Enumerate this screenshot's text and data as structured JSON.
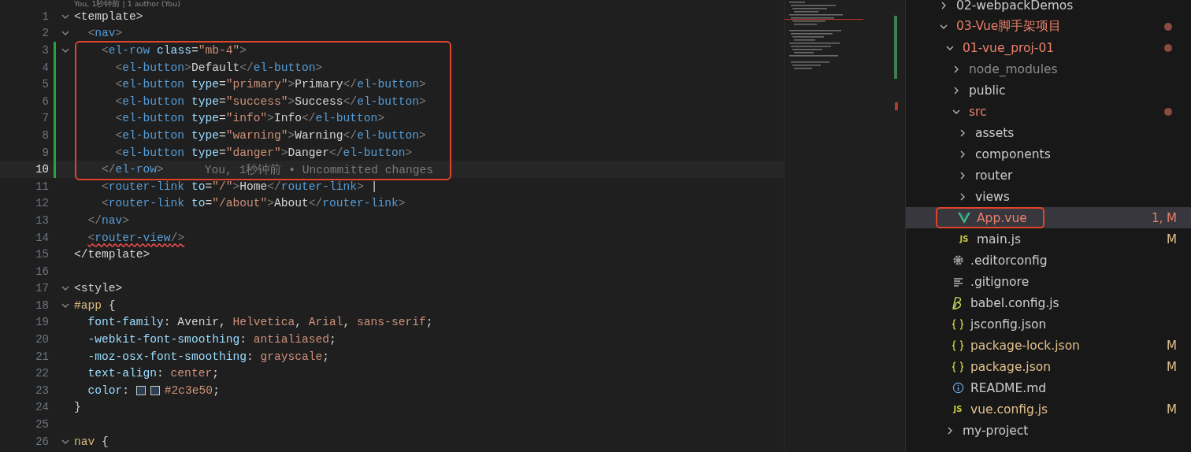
{
  "editor": {
    "codelens": "You, 1秒钟前 | 1 author (You)",
    "lines": [
      {
        "number": "1",
        "foldable": true,
        "changed": false,
        "current": false,
        "boxed": false,
        "error": false,
        "tokens": [
          {
            "kind": "text",
            "t": "<template>"
          }
        ]
      },
      {
        "number": "2",
        "foldable": true,
        "changed": false,
        "current": false,
        "boxed": false,
        "error": false,
        "tokens": [
          {
            "kind": "punct",
            "t": "  <"
          },
          {
            "kind": "tag",
            "t": "nav"
          },
          {
            "kind": "punct",
            "t": ">"
          }
        ]
      },
      {
        "number": "3",
        "foldable": true,
        "changed": true,
        "current": false,
        "boxed": true,
        "error": false,
        "tokens": [
          {
            "kind": "punct",
            "t": "    <"
          },
          {
            "kind": "tag",
            "t": "el-row"
          },
          {
            "kind": "attr",
            "t": " class"
          },
          {
            "kind": "text",
            "t": "="
          },
          {
            "kind": "str",
            "t": "\"mb-4\""
          },
          {
            "kind": "punct",
            "t": ">"
          }
        ]
      },
      {
        "number": "4",
        "foldable": false,
        "changed": true,
        "current": false,
        "boxed": true,
        "error": false,
        "tokens": [
          {
            "kind": "punct",
            "t": "      <"
          },
          {
            "kind": "tag",
            "t": "el-button"
          },
          {
            "kind": "punct",
            "t": ">"
          },
          {
            "kind": "text",
            "t": "Default"
          },
          {
            "kind": "punct",
            "t": "</"
          },
          {
            "kind": "tag",
            "t": "el-button"
          },
          {
            "kind": "punct",
            "t": ">"
          }
        ]
      },
      {
        "number": "5",
        "foldable": false,
        "changed": true,
        "current": false,
        "boxed": true,
        "error": false,
        "tokens": [
          {
            "kind": "punct",
            "t": "      <"
          },
          {
            "kind": "tag",
            "t": "el-button"
          },
          {
            "kind": "attr",
            "t": " type"
          },
          {
            "kind": "text",
            "t": "="
          },
          {
            "kind": "str",
            "t": "\"primary\""
          },
          {
            "kind": "punct",
            "t": ">"
          },
          {
            "kind": "text",
            "t": "Primary"
          },
          {
            "kind": "punct",
            "t": "</"
          },
          {
            "kind": "tag",
            "t": "el-button"
          },
          {
            "kind": "punct",
            "t": ">"
          }
        ]
      },
      {
        "number": "6",
        "foldable": false,
        "changed": true,
        "current": false,
        "boxed": true,
        "error": false,
        "tokens": [
          {
            "kind": "punct",
            "t": "      <"
          },
          {
            "kind": "tag",
            "t": "el-button"
          },
          {
            "kind": "attr",
            "t": " type"
          },
          {
            "kind": "text",
            "t": "="
          },
          {
            "kind": "str",
            "t": "\"success\""
          },
          {
            "kind": "punct",
            "t": ">"
          },
          {
            "kind": "text",
            "t": "Success"
          },
          {
            "kind": "punct",
            "t": "</"
          },
          {
            "kind": "tag",
            "t": "el-button"
          },
          {
            "kind": "punct",
            "t": ">"
          }
        ]
      },
      {
        "number": "7",
        "foldable": false,
        "changed": true,
        "current": false,
        "boxed": true,
        "error": false,
        "tokens": [
          {
            "kind": "punct",
            "t": "      <"
          },
          {
            "kind": "tag",
            "t": "el-button"
          },
          {
            "kind": "attr",
            "t": " type"
          },
          {
            "kind": "text",
            "t": "="
          },
          {
            "kind": "str",
            "t": "\"info\""
          },
          {
            "kind": "punct",
            "t": ">"
          },
          {
            "kind": "text",
            "t": "Info"
          },
          {
            "kind": "punct",
            "t": "</"
          },
          {
            "kind": "tag",
            "t": "el-button"
          },
          {
            "kind": "punct",
            "t": ">"
          }
        ]
      },
      {
        "number": "8",
        "foldable": false,
        "changed": true,
        "current": false,
        "boxed": true,
        "error": false,
        "tokens": [
          {
            "kind": "punct",
            "t": "      <"
          },
          {
            "kind": "tag",
            "t": "el-button"
          },
          {
            "kind": "attr",
            "t": " type"
          },
          {
            "kind": "text",
            "t": "="
          },
          {
            "kind": "str",
            "t": "\"warning\""
          },
          {
            "kind": "punct",
            "t": ">"
          },
          {
            "kind": "text",
            "t": "Warning"
          },
          {
            "kind": "punct",
            "t": "</"
          },
          {
            "kind": "tag",
            "t": "el-button"
          },
          {
            "kind": "punct",
            "t": ">"
          }
        ]
      },
      {
        "number": "9",
        "foldable": false,
        "changed": true,
        "current": false,
        "boxed": true,
        "error": false,
        "tokens": [
          {
            "kind": "punct",
            "t": "      <"
          },
          {
            "kind": "tag",
            "t": "el-button"
          },
          {
            "kind": "attr",
            "t": " type"
          },
          {
            "kind": "text",
            "t": "="
          },
          {
            "kind": "str",
            "t": "\"danger\""
          },
          {
            "kind": "punct",
            "t": ">"
          },
          {
            "kind": "text",
            "t": "Danger"
          },
          {
            "kind": "punct",
            "t": "</"
          },
          {
            "kind": "tag",
            "t": "el-button"
          },
          {
            "kind": "punct",
            "t": ">"
          }
        ]
      },
      {
        "number": "10",
        "foldable": false,
        "changed": true,
        "current": true,
        "boxed": true,
        "error": false,
        "blame": "You, 1秒钟前 • Uncommitted changes",
        "tokens": [
          {
            "kind": "punct",
            "t": "    </"
          },
          {
            "kind": "tag",
            "t": "el-row"
          },
          {
            "kind": "punct",
            "t": ">"
          }
        ]
      },
      {
        "number": "11",
        "foldable": false,
        "changed": false,
        "current": false,
        "boxed": false,
        "error": false,
        "tokens": [
          {
            "kind": "punct",
            "t": "    <"
          },
          {
            "kind": "tag",
            "t": "router-link"
          },
          {
            "kind": "attr",
            "t": " to"
          },
          {
            "kind": "text",
            "t": "="
          },
          {
            "kind": "str",
            "t": "\"/\""
          },
          {
            "kind": "punct",
            "t": ">"
          },
          {
            "kind": "text",
            "t": "Home"
          },
          {
            "kind": "punct",
            "t": "</"
          },
          {
            "kind": "tag",
            "t": "router-link"
          },
          {
            "kind": "punct",
            "t": ">"
          },
          {
            "kind": "text",
            "t": " |"
          }
        ]
      },
      {
        "number": "12",
        "foldable": false,
        "changed": false,
        "current": false,
        "boxed": false,
        "error": false,
        "tokens": [
          {
            "kind": "punct",
            "t": "    <"
          },
          {
            "kind": "tag",
            "t": "router-link"
          },
          {
            "kind": "attr",
            "t": " to"
          },
          {
            "kind": "text",
            "t": "="
          },
          {
            "kind": "str",
            "t": "\"/about\""
          },
          {
            "kind": "punct",
            "t": ">"
          },
          {
            "kind": "text",
            "t": "About"
          },
          {
            "kind": "punct",
            "t": "</"
          },
          {
            "kind": "tag",
            "t": "router-link"
          },
          {
            "kind": "punct",
            "t": ">"
          }
        ]
      },
      {
        "number": "13",
        "foldable": false,
        "changed": false,
        "current": false,
        "boxed": false,
        "error": false,
        "tokens": [
          {
            "kind": "punct",
            "t": "  </"
          },
          {
            "kind": "tag",
            "t": "nav"
          },
          {
            "kind": "punct",
            "t": ">"
          }
        ]
      },
      {
        "number": "14",
        "foldable": false,
        "changed": false,
        "current": false,
        "boxed": false,
        "error": true,
        "tokens": [
          {
            "kind": "punct",
            "t": "  <"
          },
          {
            "kind": "tag",
            "t": "router-view"
          },
          {
            "kind": "punct",
            "t": "/>"
          }
        ]
      },
      {
        "number": "15",
        "foldable": false,
        "changed": false,
        "current": false,
        "boxed": false,
        "error": false,
        "tokens": [
          {
            "kind": "text",
            "t": "</template>"
          }
        ]
      },
      {
        "number": "16",
        "foldable": false,
        "changed": false,
        "current": false,
        "boxed": false
      },
      {
        "number": "17",
        "foldable": true,
        "changed": false,
        "current": false,
        "boxed": false,
        "error": false,
        "tokens": [
          {
            "kind": "text",
            "t": "<style>"
          }
        ]
      },
      {
        "number": "18",
        "foldable": true,
        "changed": false,
        "current": false,
        "boxed": false,
        "error": false,
        "tokens": [
          {
            "kind": "sel",
            "t": "#app"
          },
          {
            "kind": "text",
            "t": " {"
          }
        ]
      },
      {
        "number": "19",
        "foldable": false,
        "changed": false,
        "current": false,
        "boxed": false,
        "error": false,
        "tokens": [
          {
            "kind": "prop",
            "t": "  font-family"
          },
          {
            "kind": "text",
            "t": ": Avenir, "
          },
          {
            "kind": "val",
            "t": "Helvetica"
          },
          {
            "kind": "text",
            "t": ", "
          },
          {
            "kind": "val",
            "t": "Arial"
          },
          {
            "kind": "text",
            "t": ", "
          },
          {
            "kind": "val",
            "t": "sans-serif"
          },
          {
            "kind": "text",
            "t": ";"
          }
        ]
      },
      {
        "number": "20",
        "foldable": false,
        "changed": false,
        "current": false,
        "boxed": false,
        "error": false,
        "tokens": [
          {
            "kind": "prop",
            "t": "  -webkit-font-smoothing"
          },
          {
            "kind": "text",
            "t": ": "
          },
          {
            "kind": "val",
            "t": "antialiased"
          },
          {
            "kind": "text",
            "t": ";"
          }
        ]
      },
      {
        "number": "21",
        "foldable": false,
        "changed": false,
        "current": false,
        "boxed": false,
        "error": false,
        "tokens": [
          {
            "kind": "prop",
            "t": "  -moz-osx-font-smoothing"
          },
          {
            "kind": "text",
            "t": ": "
          },
          {
            "kind": "val",
            "t": "grayscale"
          },
          {
            "kind": "text",
            "t": ";"
          }
        ]
      },
      {
        "number": "22",
        "foldable": false,
        "changed": false,
        "current": false,
        "boxed": false,
        "error": false,
        "tokens": [
          {
            "kind": "prop",
            "t": "  text-align"
          },
          {
            "kind": "text",
            "t": ": "
          },
          {
            "kind": "val",
            "t": "center"
          },
          {
            "kind": "text",
            "t": ";"
          }
        ]
      },
      {
        "number": "23",
        "foldable": false,
        "changed": false,
        "current": false,
        "boxed": false,
        "error": false,
        "tokens": [
          {
            "kind": "prop",
            "t": "  color"
          },
          {
            "kind": "text",
            "t": ": "
          },
          {
            "kind": "swatch",
            "color": "#2c3e50"
          },
          {
            "kind": "swatch",
            "color": "#2c3e50"
          },
          {
            "kind": "val",
            "t": "#2c3e50"
          },
          {
            "kind": "text",
            "t": ";"
          }
        ]
      },
      {
        "number": "24",
        "foldable": false,
        "changed": false,
        "current": false,
        "boxed": false,
        "error": false,
        "tokens": [
          {
            "kind": "text",
            "t": "}"
          }
        ]
      },
      {
        "number": "25",
        "foldable": false,
        "changed": false,
        "current": false,
        "boxed": false
      },
      {
        "number": "26",
        "foldable": true,
        "changed": false,
        "current": false,
        "boxed": false,
        "error": false,
        "tokens": [
          {
            "kind": "sel",
            "t": "nav"
          },
          {
            "kind": "text",
            "t": " {"
          }
        ]
      }
    ]
  },
  "explorer": {
    "items": [
      {
        "label": "02-webpackDemos",
        "kind": "folder",
        "expanded": false,
        "color": "#cccccc",
        "dot": false,
        "selected": false,
        "boxed": false
      },
      {
        "label": "03-Vue脚手架项目",
        "kind": "folder",
        "expanded": true,
        "color": "#e8806a",
        "dot": true,
        "selected": false,
        "boxed": false,
        "children": [
          {
            "label": "01-vue_proj-01",
            "kind": "folder",
            "expanded": true,
            "color": "#e8806a",
            "dot": true,
            "selected": false,
            "boxed": false,
            "children": [
              {
                "label": "node_modules",
                "kind": "folder",
                "expanded": false,
                "color": "#8c8c8c",
                "dot": false,
                "selected": false,
                "boxed": false
              },
              {
                "label": "public",
                "kind": "folder",
                "expanded": false,
                "color": "#cccccc",
                "dot": false,
                "selected": false,
                "boxed": false
              },
              {
                "label": "src",
                "kind": "folder",
                "expanded": true,
                "color": "#e8806a",
                "dot": true,
                "selected": false,
                "boxed": false,
                "children": [
                  {
                    "label": "assets",
                    "kind": "folder",
                    "expanded": false,
                    "color": "#cccccc",
                    "dot": false,
                    "selected": false,
                    "boxed": false
                  },
                  {
                    "label": "components",
                    "kind": "folder",
                    "expanded": false,
                    "color": "#cccccc",
                    "dot": false,
                    "selected": false,
                    "boxed": false
                  },
                  {
                    "label": "router",
                    "kind": "folder",
                    "expanded": false,
                    "color": "#cccccc",
                    "dot": false,
                    "selected": false,
                    "boxed": false
                  },
                  {
                    "label": "views",
                    "kind": "folder",
                    "expanded": false,
                    "color": "#cccccc",
                    "dot": false,
                    "selected": false,
                    "boxed": false
                  },
                  {
                    "label": "App.vue",
                    "kind": "vue",
                    "color": "#e8806a",
                    "badge": "1, M",
                    "dot": false,
                    "selected": true,
                    "boxed": true
                  },
                  {
                    "label": "main.js",
                    "kind": "js",
                    "icon_text": "JS",
                    "color": "#cccccc",
                    "badge": "M",
                    "dot": false,
                    "selected": false,
                    "boxed": false
                  }
                ]
              },
              {
                "label": ".editorconfig",
                "kind": "gear",
                "color": "#cccccc",
                "dot": false,
                "selected": false,
                "boxed": false
              },
              {
                "label": ".gitignore",
                "kind": "lines",
                "color": "#cccccc",
                "dot": false,
                "selected": false,
                "boxed": false
              },
              {
                "label": "babel.config.js",
                "kind": "babel",
                "color": "#cccccc",
                "dot": false,
                "selected": false,
                "boxed": false
              },
              {
                "label": "jsconfig.json",
                "kind": "json",
                "color": "#cccccc",
                "dot": false,
                "selected": false,
                "boxed": false
              },
              {
                "label": "package-lock.json",
                "kind": "json",
                "color": "#e2c08d",
                "badge": "M",
                "dot": false,
                "selected": false,
                "boxed": false
              },
              {
                "label": "package.json",
                "kind": "json",
                "color": "#e2c08d",
                "badge": "M",
                "dot": false,
                "selected": false,
                "boxed": false
              },
              {
                "label": "README.md",
                "kind": "info",
                "color": "#cccccc",
                "dot": false,
                "selected": false,
                "boxed": false
              },
              {
                "label": "vue.config.js",
                "kind": "js",
                "icon_text": "JS",
                "color": "#e2c08d",
                "badge": "M",
                "dot": false,
                "selected": false,
                "boxed": false
              }
            ]
          },
          {
            "label": "my-project",
            "kind": "folder",
            "expanded": false,
            "color": "#cccccc",
            "dot": false,
            "selected": false,
            "boxed": false
          }
        ]
      }
    ]
  }
}
